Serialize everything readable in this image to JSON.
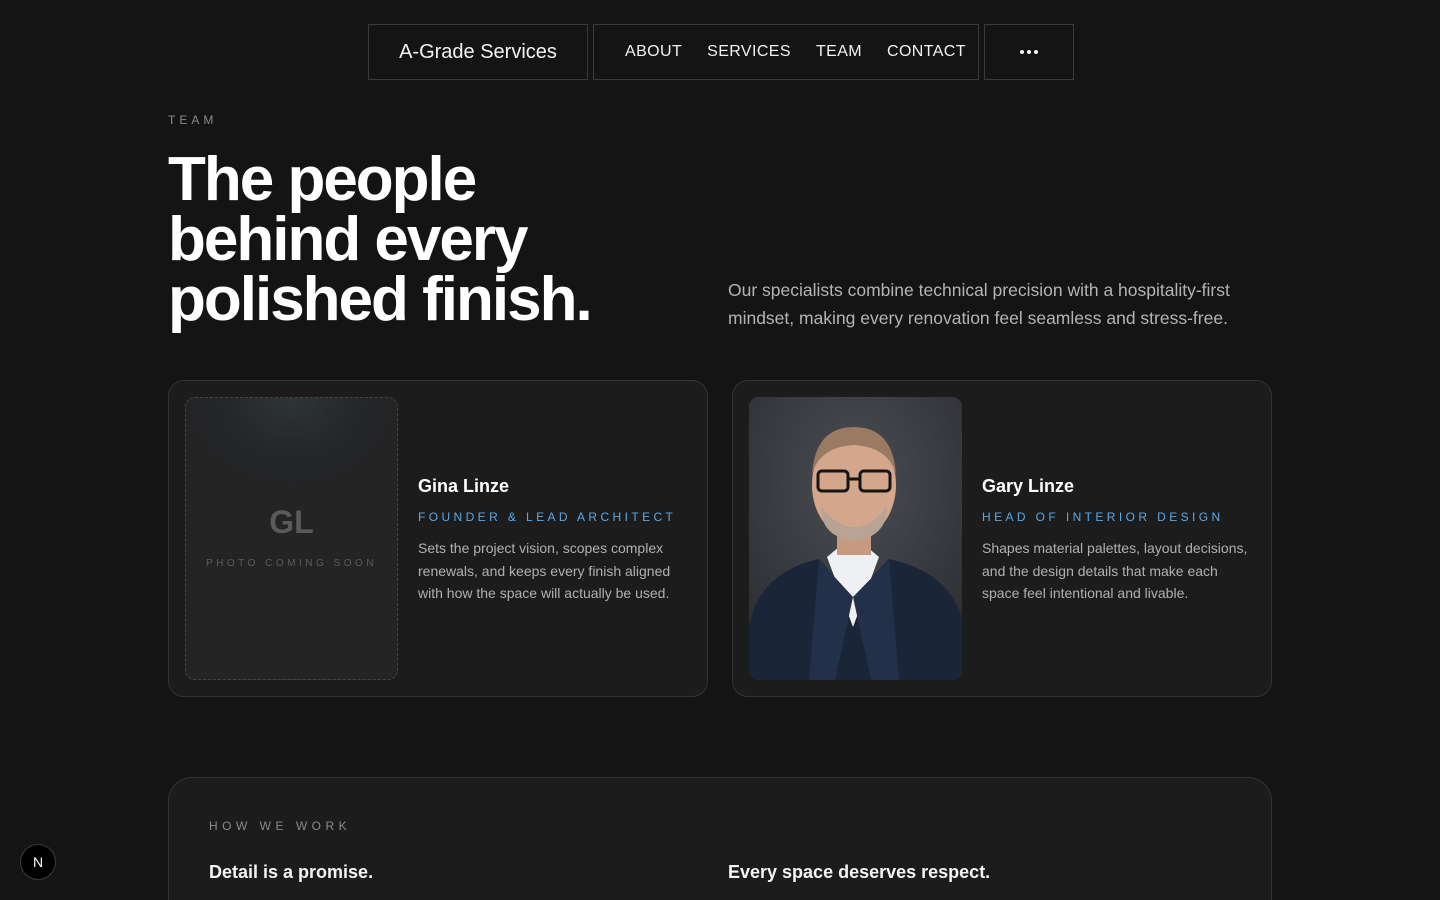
{
  "nav": {
    "brand": "A-Grade Services",
    "links": [
      "ABOUT",
      "SERVICES",
      "TEAM",
      "CONTACT"
    ],
    "more_icon": "ellipsis-icon"
  },
  "hero": {
    "eyebrow": "TEAM",
    "headline": "The people behind every polished finish.",
    "intro": "Our specialists combine technical precision with a hospitality-first mindset, making every renovation feel seamless and stress-free."
  },
  "team": [
    {
      "name": "Gina Linze",
      "role": "FOUNDER & LEAD ARCHITECT",
      "bio": "Sets the project vision, scopes complex renewals, and keeps every finish aligned with how the space will actually be used.",
      "initials": "GL",
      "photo_placeholder": "PHOTO COMING SOON"
    },
    {
      "name": "Gary Linze",
      "role": "HEAD OF INTERIOR DESIGN",
      "bio": "Shapes material palettes, layout decisions, and the design details that make each space feel intentional and livable."
    }
  ],
  "work": {
    "eyebrow": "HOW WE WORK",
    "items": [
      "Detail is a promise.",
      "Every space deserves respect."
    ]
  },
  "badge": {
    "label": "N"
  },
  "colors": {
    "background": "#141414",
    "card": "#1c1c1c",
    "accent": "#5aa8e6"
  }
}
